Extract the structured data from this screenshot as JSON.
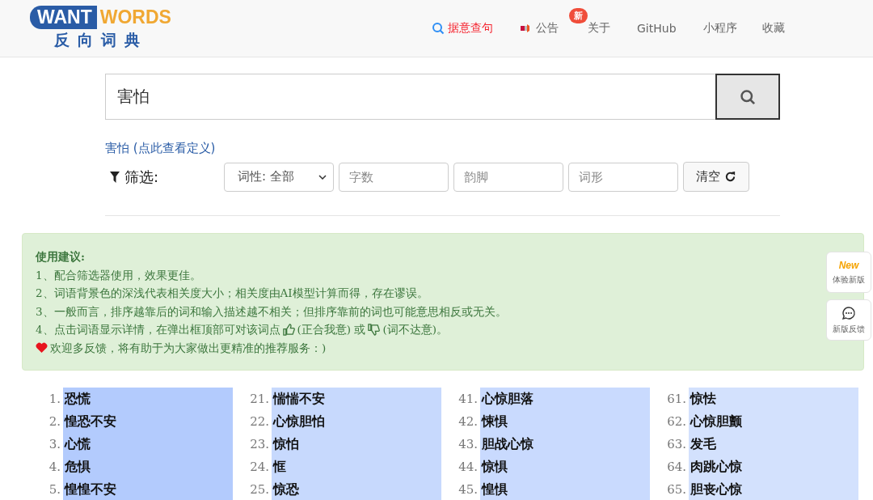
{
  "logo": {
    "brand_left": "WANT",
    "brand_right": "WORDS",
    "subtitle": "反向词典"
  },
  "nav": [
    {
      "label": "据意查句",
      "kind": "search",
      "selected": true
    },
    {
      "label": "公告",
      "kind": "announce",
      "selected": false,
      "badge": "新"
    },
    {
      "label": "关于",
      "kind": "plain",
      "selected": false
    },
    {
      "label": "GitHub",
      "kind": "plain",
      "selected": false
    },
    {
      "label": "小程序",
      "kind": "plain",
      "selected": false
    },
    {
      "label": "收藏",
      "kind": "plain",
      "selected": false
    }
  ],
  "search": {
    "value": "害怕"
  },
  "definition_link": "害怕 (点此查看定义)",
  "filter": {
    "label": "筛选:",
    "select": "词性: 全部",
    "fields": [
      {
        "placeholder": "字数"
      },
      {
        "placeholder": "韵脚"
      },
      {
        "placeholder": "词形"
      }
    ],
    "clear_button": "清空"
  },
  "tips": {
    "title": "使用建议:",
    "lines": [
      {
        "kind": "text",
        "text": "1、配合筛选器使用，效果更佳。"
      },
      {
        "kind": "text",
        "text": "2、词语背景色的深浅代表相关度大小；相关度由AI模型计算而得，存在谬误。"
      },
      {
        "kind": "text",
        "text": "3、一般而言，排序越靠后的词和输入描述越不相关；但排序靠前的词也可能意思相反或无关。"
      },
      {
        "kind": "feedback",
        "parts": [
          "4、点击词语显示详情，在弹出框顶部可对该词点",
          "(正合我意) 或",
          "(词不达意)。"
        ]
      },
      {
        "kind": "heart",
        "text": "欢迎多反馈，将有助于为大家做出更精准的推荐服务：)"
      }
    ]
  },
  "side_buttons": [
    {
      "kind": "new",
      "badge": "New",
      "label": "体验新版"
    },
    {
      "kind": "chat",
      "label": "新版反馈"
    }
  ],
  "results": [
    [
      {
        "n": "1.",
        "word": "恐慌",
        "color": "#b3cbfd"
      },
      {
        "n": "2.",
        "word": "惶恐不安",
        "color": "#b3cbfd"
      },
      {
        "n": "3.",
        "word": "心慌",
        "color": "#b3cbfd"
      },
      {
        "n": "4.",
        "word": "危惧",
        "color": "#b3cbfd"
      },
      {
        "n": "5.",
        "word": "惶惶不安",
        "color": "#b3cbfd"
      }
    ],
    [
      {
        "n": "21.",
        "word": "惴惴不安",
        "color": "#c7d9fd"
      },
      {
        "n": "22.",
        "word": "心惊胆怕",
        "color": "#c7d9fd"
      },
      {
        "n": "23.",
        "word": "惊怕",
        "color": "#c7d9fd"
      },
      {
        "n": "24.",
        "word": "恇",
        "color": "#c7d9fd"
      },
      {
        "n": "25.",
        "word": "惊恐",
        "color": "#c7d9fd"
      }
    ],
    [
      {
        "n": "41.",
        "word": "心惊胆落",
        "color": "#c9dafe"
      },
      {
        "n": "42.",
        "word": "悚惧",
        "color": "#c9dafe"
      },
      {
        "n": "43.",
        "word": "胆战心惊",
        "color": "#c9dafe"
      },
      {
        "n": "44.",
        "word": "惊惧",
        "color": "#c9dafe"
      },
      {
        "n": "45.",
        "word": "惶惧",
        "color": "#c9dafe"
      }
    ],
    [
      {
        "n": "61.",
        "word": "惊怯",
        "color": "#d3e1fd"
      },
      {
        "n": "62.",
        "word": "心惊胆颤",
        "color": "#d3e1fd"
      },
      {
        "n": "63.",
        "word": "发毛",
        "color": "#d3e1fd"
      },
      {
        "n": "64.",
        "word": "肉跳心惊",
        "color": "#d3e1fd"
      },
      {
        "n": "65.",
        "word": "胆丧心惊",
        "color": "#d3e1fd"
      }
    ]
  ]
}
